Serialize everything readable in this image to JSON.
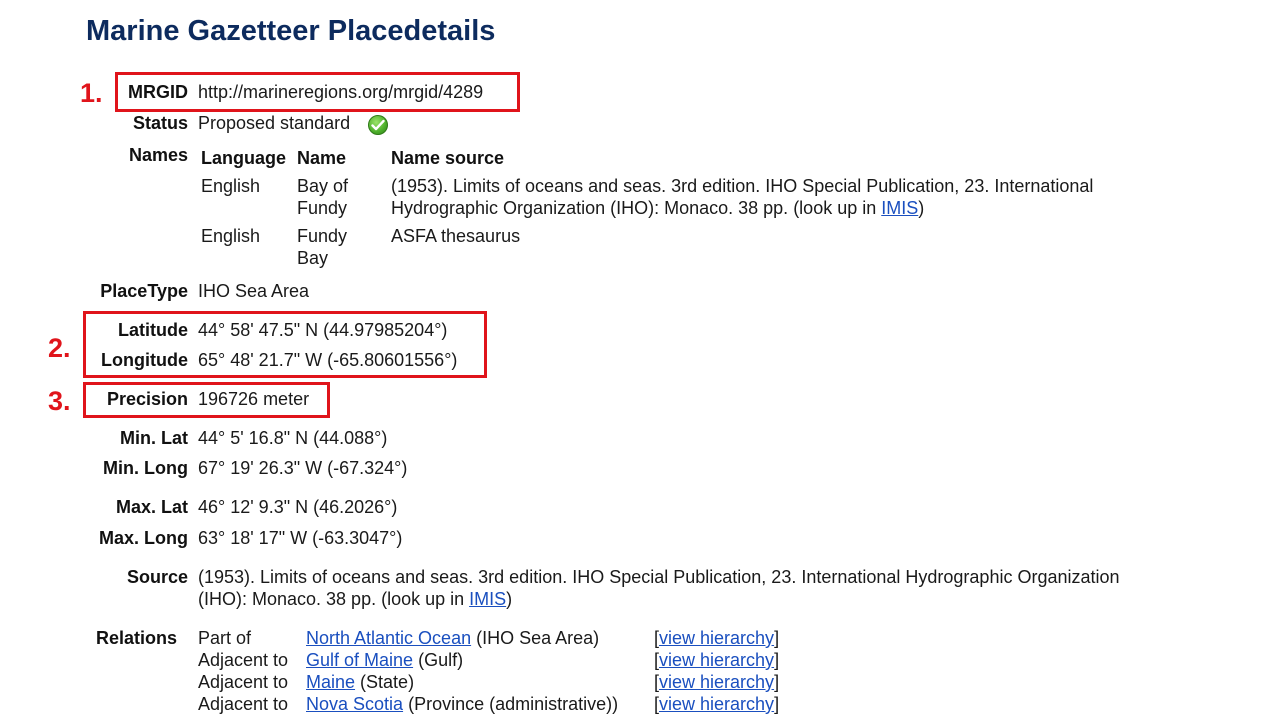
{
  "page_title": "Marine Gazetteer Placedetails",
  "markers": {
    "m1": "1.",
    "m2": "2.",
    "m3": "3."
  },
  "mrgid": {
    "label": "MRGID",
    "value": "http://marineregions.org/mrgid/4289"
  },
  "status": {
    "label": "Status",
    "value": "Proposed standard",
    "icon": "check-circle-icon",
    "icon_color": "#4cae2a"
  },
  "names": {
    "label": "Names",
    "columns": [
      "Language",
      "Name",
      "Name source"
    ],
    "rows": [
      {
        "language": "English",
        "name_line1": "Bay of",
        "name_line2": "Fundy",
        "source_line1": "(1953). Limits of oceans and seas. 3rd edition. IHO Special Publication, 23. International",
        "source_line2_pre": "Hydrographic Organization (IHO): Monaco. 38 pp. (look up in ",
        "source_link": "IMIS",
        "source_line2_post": ")"
      },
      {
        "language": "English",
        "name_line1": "Fundy",
        "name_line2": "Bay",
        "source": "ASFA thesaurus"
      }
    ]
  },
  "placetype": {
    "label": "PlaceType",
    "value": "IHO Sea Area"
  },
  "latitude": {
    "label": "Latitude",
    "value": "44° 58' 47.5\" N (44.97985204°)"
  },
  "longitude": {
    "label": "Longitude",
    "value": "65° 48' 21.7\" W (-65.80601556°)"
  },
  "precision": {
    "label": "Precision",
    "value": "196726 meter"
  },
  "min_lat": {
    "label": "Min. Lat",
    "value": "44° 5' 16.8\" N (44.088°)"
  },
  "min_long": {
    "label": "Min. Long",
    "value": "67° 19' 26.3\" W (-67.324°)"
  },
  "max_lat": {
    "label": "Max. Lat",
    "value": "46° 12' 9.3\" N (46.2026°)"
  },
  "max_long": {
    "label": "Max. Long",
    "value": "63° 18' 17\" W (-63.3047°)"
  },
  "source": {
    "label": "Source",
    "line1": "(1953). Limits of oceans and seas. 3rd edition. IHO Special Publication, 23. International Hydrographic Organization",
    "line2_pre": "(IHO): Monaco. 38 pp. (look up in ",
    "link": "IMIS",
    "line2_post": ")"
  },
  "relations": {
    "label": "Relations",
    "rows": [
      {
        "relation": "Part of",
        "place": "North Atlantic Ocean",
        "type": "(IHO Sea Area)",
        "lb": "[",
        "action": "view hierarchy",
        "rb": "]"
      },
      {
        "relation": "Adjacent to",
        "place": "Gulf of Maine",
        "type": "(Gulf)",
        "lb": "[",
        "action": "view hierarchy",
        "rb": "]"
      },
      {
        "relation": "Adjacent to",
        "place": "Maine",
        "type": "(State)",
        "lb": "[",
        "action": "view hierarchy",
        "rb": "]"
      },
      {
        "relation": "Adjacent to",
        "place": "Nova Scotia",
        "type": "(Province (administrative))",
        "lb": "[",
        "action": "view hierarchy",
        "rb": "]"
      }
    ]
  },
  "colors": {
    "title": "#0d2b5e",
    "link": "#1a4fbf",
    "highlight": "#e0141b"
  }
}
